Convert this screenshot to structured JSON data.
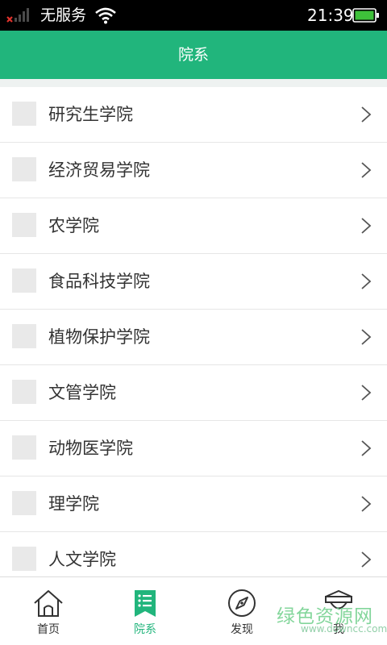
{
  "status_bar": {
    "carrier": "无服务",
    "time": "21:39",
    "signal_icon": "signal-none-icon",
    "wifi_icon": "wifi-icon",
    "battery_icon": "battery-icon"
  },
  "header": {
    "title": "院系"
  },
  "colleges": [
    {
      "label": "研究生学院"
    },
    {
      "label": "经济贸易学院"
    },
    {
      "label": "农学院"
    },
    {
      "label": "食品科技学院"
    },
    {
      "label": "植物保护学院"
    },
    {
      "label": "文管学院"
    },
    {
      "label": "动物医学院"
    },
    {
      "label": "理学院"
    },
    {
      "label": "人文学院"
    }
  ],
  "tabbar": {
    "tabs": [
      {
        "label": "首页",
        "icon": "home-icon"
      },
      {
        "label": "院系",
        "icon": "list-bookmark-icon",
        "active": true
      },
      {
        "label": "发现",
        "icon": "compass-icon"
      },
      {
        "label": "我",
        "icon": "profile-icon"
      }
    ]
  },
  "watermark": {
    "cn": "绿色资源网",
    "en": "www.downcc.com"
  },
  "colors": {
    "accent": "#21b57c",
    "statusbar": "#000000",
    "gap": "#eef2f1",
    "thumb": "#e9e9e9"
  }
}
